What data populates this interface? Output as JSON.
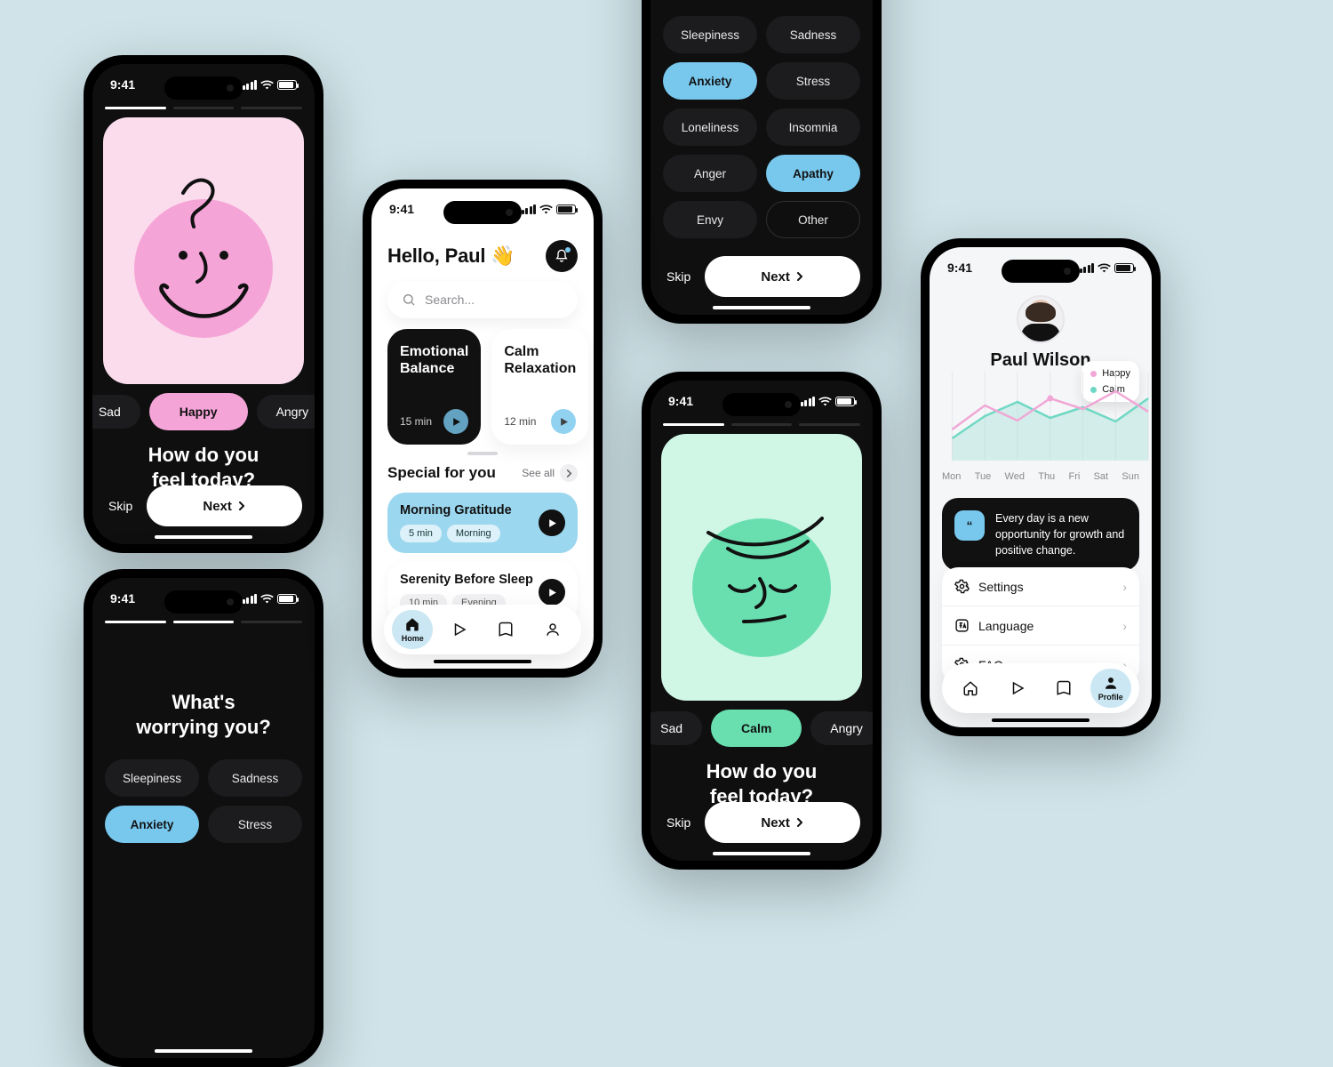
{
  "status_time": "9:41",
  "phone1": {
    "moods": {
      "left": "Sad",
      "center": "Happy",
      "right": "Angry"
    },
    "question_l1": "How do you",
    "question_l2": "feel today?",
    "skip": "Skip",
    "next": "Next"
  },
  "phone2": {
    "question_l1": "What's",
    "question_l2": "worrying you?",
    "chips": [
      "Sleepiness",
      "Sadness",
      "Anxiety",
      "Stress"
    ]
  },
  "phone3_top": {
    "chips": [
      "Sleepiness",
      "Sadness",
      "Anxiety",
      "Stress",
      "Loneliness",
      "Insomnia",
      "Anger",
      "Apathy",
      "Envy",
      "Other"
    ],
    "skip": "Skip",
    "next": "Next"
  },
  "home": {
    "greeting": "Hello, Paul 👋",
    "search_placeholder": "Search...",
    "card1_t1": "Emotional",
    "card1_t2": "Balance",
    "card1_dur": "15 min",
    "card2_t1": "Calm",
    "card2_t2": "Relaxation",
    "card2_dur": "12 min",
    "special_title": "Special for you",
    "seeall": "See all",
    "row1_title": "Morning Gratitude",
    "row1_tag1": "5 min",
    "row1_tag2": "Morning",
    "row2_title": "Serenity Before Sleep",
    "row2_tag1": "10 min",
    "row2_tag2": "Evening",
    "tab_home": "Home"
  },
  "calm": {
    "moods": {
      "left": "Sad",
      "center": "Calm",
      "right": "Angry"
    },
    "question_l1": "How do you",
    "question_l2": "feel today?",
    "skip": "Skip",
    "next": "Next"
  },
  "profile": {
    "name": "Paul Wilson",
    "legend_happy": "Happy",
    "legend_calm": "Calm",
    "days": [
      "Mon",
      "Tue",
      "Wed",
      "Thu",
      "Fri",
      "Sat",
      "Sun"
    ],
    "quote": "Every day is a new opportunity for growth and positive change.",
    "settings": "Settings",
    "language": "Language",
    "faq": "FAQ",
    "tab_profile": "Profile"
  },
  "chart_data": {
    "type": "line",
    "x": [
      "Mon",
      "Tue",
      "Wed",
      "Thu",
      "Fri",
      "Sat",
      "Sun"
    ],
    "series": [
      {
        "name": "Happy",
        "color": "#f1a6d6",
        "values": [
          35,
          62,
          45,
          70,
          58,
          78,
          55
        ]
      },
      {
        "name": "Calm",
        "color": "#6fd8c4",
        "values": [
          25,
          50,
          66,
          48,
          60,
          44,
          70
        ]
      }
    ],
    "ylim": [
      0,
      100
    ]
  }
}
